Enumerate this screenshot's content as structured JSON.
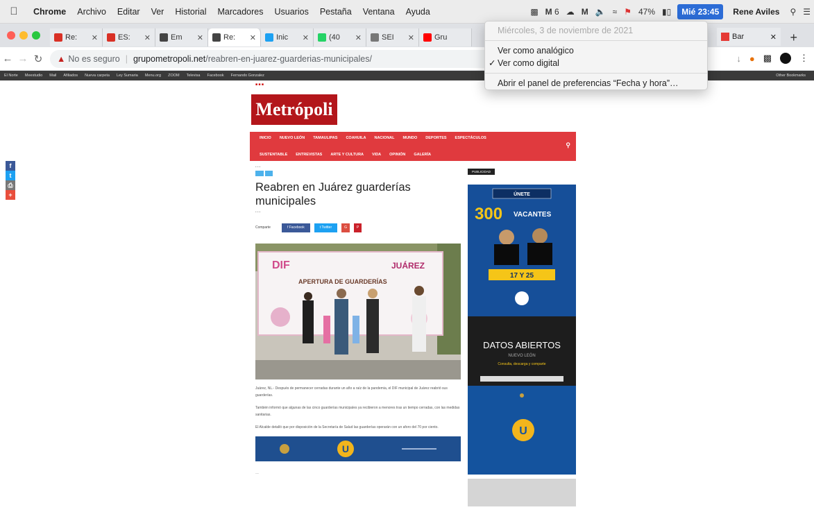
{
  "menubar": {
    "apple": "",
    "app": "Chrome",
    "menus": [
      "Archivo",
      "Editar",
      "Ver",
      "Historial",
      "Marcadores",
      "Usuarios",
      "Pestaña",
      "Ventana",
      "Ayuda"
    ],
    "status_mail": "6",
    "battery": "47%",
    "clock": "Mié 23:45",
    "user": "Rene Aviles"
  },
  "tabs": [
    {
      "label": "Re:",
      "color": "#d93025"
    },
    {
      "label": "ES:",
      "color": "#d93025"
    },
    {
      "label": "Em",
      "color": "#444444"
    },
    {
      "label": "Re:",
      "color": "#444444"
    },
    {
      "label": "Inic",
      "color": "#1da1f2"
    },
    {
      "label": "(40",
      "color": "#25d366"
    },
    {
      "label": "SEI",
      "color": "#777777"
    },
    {
      "label": "Gru",
      "color": "#ff0000"
    }
  ],
  "tab_right": {
    "label": "Bar"
  },
  "addressbar": {
    "insecure_label": "No es seguro",
    "domain": "grupometropoli.net",
    "path": "/reabren-en-juarez-guarderias-municipales/"
  },
  "bookmarks": [
    "El Norte",
    "Meestudio",
    "Mail",
    "Afiliados",
    "Nueva carpeta",
    "Ley Sumaria",
    "Menu.org",
    "ZOOM",
    "Televisa",
    "Facebook",
    "Fernando Gonzalez",
    "Other Bookmarks"
  ],
  "dropdown": {
    "date": "Miércoles, 3 de noviembre de 2021",
    "items": [
      "Ver como analógico",
      "Ver como digital"
    ],
    "checked": "Ver como digital",
    "pref": "Abrir el panel de preferencias “Fecha y hora”…"
  },
  "site": {
    "logo": "Metrópoli",
    "nav_row1": [
      "INICIO",
      "NUEVO LEÓN",
      "TAMAULIPAS",
      "COAHUILA",
      "NACIONAL",
      "MUNDO",
      "DEPORTES",
      "ESPECTÁCULOS"
    ],
    "nav_row2": [
      "SUSTENTABLE",
      "ENTREVISTAS",
      "ARTE Y CULTURA",
      "VIDA",
      "OPINIÓN",
      "GALERÍA"
    ],
    "article": {
      "title": "Reabren en Juárez guarderías municipales",
      "share_label": "Comparte",
      "share_buttons": [
        "Facebook",
        "Twitter"
      ],
      "hero_sign_left": "DIF",
      "hero_sign_right": "JUÁREZ",
      "hero_sign_banner": "APERTURA DE GUARDERÍAS",
      "paragraphs": [
        "Juárez, NL.- Después de permanecer cerradas durante un año a raíz de la pandemia, el DIF municipal de Juárez reabrió sus guarderías.",
        "También informó que algunas de las cinco guarderías municipales ya recibieron a menores tras un tiempo cerradas, con las medidas sanitarias.",
        "El Alcalde detalló que por disposición de la Secretaría de Salud las guarderías operarán con un aforo del 70 por ciento."
      ]
    },
    "sidebar_tag": "PUBLICIDAD",
    "ad1": {
      "headline": "ÚNETE",
      "number": "300",
      "word": "VACANTES",
      "dates": "17 Y 25"
    },
    "ad2": {
      "title": "DATOS ABIERTOS",
      "subtitle": "NUEVO LEÓN",
      "tagline": "Consulta, descarga y comparte"
    }
  }
}
